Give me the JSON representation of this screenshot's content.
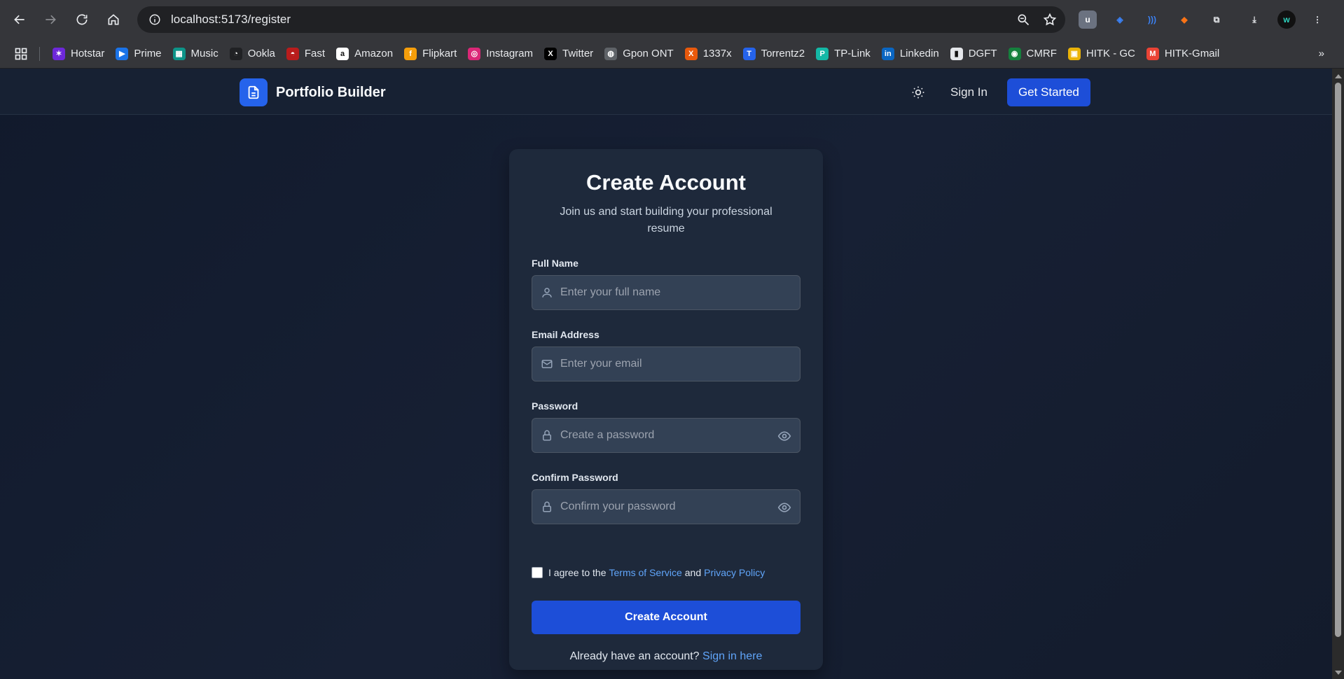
{
  "browser": {
    "url": "localhost:5173/register",
    "bookmarks": [
      {
        "label": "Hotstar",
        "color": "#6d28d9",
        "glyph": "✶"
      },
      {
        "label": "Prime",
        "color": "#1a73e8",
        "glyph": "▶"
      },
      {
        "label": "Music",
        "color": "#0d9488",
        "glyph": "▦"
      },
      {
        "label": "Ookla",
        "color": "#202124",
        "glyph": "◔"
      },
      {
        "label": "Fast",
        "color": "#b91c1c",
        "glyph": "◓"
      },
      {
        "label": "Amazon",
        "color": "#ffffff",
        "glyph": "a"
      },
      {
        "label": "Flipkart",
        "color": "#f59e0b",
        "glyph": "f"
      },
      {
        "label": "Instagram",
        "color": "#db2777",
        "glyph": "◎"
      },
      {
        "label": "Twitter",
        "color": "#000000",
        "glyph": "X"
      },
      {
        "label": "Gpon ONT",
        "color": "#5f6368",
        "glyph": "◍"
      },
      {
        "label": "1337x",
        "color": "#e8590c",
        "glyph": "X"
      },
      {
        "label": "Torrentz2",
        "color": "#2563eb",
        "glyph": "T"
      },
      {
        "label": "TP-Link",
        "color": "#14b8a6",
        "glyph": "P"
      },
      {
        "label": "Linkedin",
        "color": "#0a66c2",
        "glyph": "in"
      },
      {
        "label": "DGFT",
        "color": "#e5e7eb",
        "glyph": "▮"
      },
      {
        "label": "CMRF",
        "color": "#15803d",
        "glyph": "◉"
      },
      {
        "label": "HITK - GC",
        "color": "#eab308",
        "glyph": "▣"
      },
      {
        "label": "HITK-Gmail",
        "color": "#ea4335",
        "glyph": "M"
      }
    ]
  },
  "header": {
    "brand": "Portfolio Builder",
    "sign_in": "Sign In",
    "get_started": "Get Started",
    "accent": "#1d4ed8"
  },
  "form": {
    "title": "Create Account",
    "subtitle": "Join us and start building your professional resume",
    "full_name_label": "Full Name",
    "full_name_placeholder": "Enter your full name",
    "email_label": "Email Address",
    "email_placeholder": "Enter your email",
    "password_label": "Password",
    "password_placeholder": "Create a password",
    "confirm_label": "Confirm Password",
    "confirm_placeholder": "Confirm your password",
    "terms_prefix": "I agree to the",
    "terms_link": "Terms of Service",
    "terms_and": "and",
    "privacy_link": "Privacy Policy",
    "submit": "Create Account",
    "already": "Already have an account?",
    "sign_in_here": "Sign in here"
  }
}
